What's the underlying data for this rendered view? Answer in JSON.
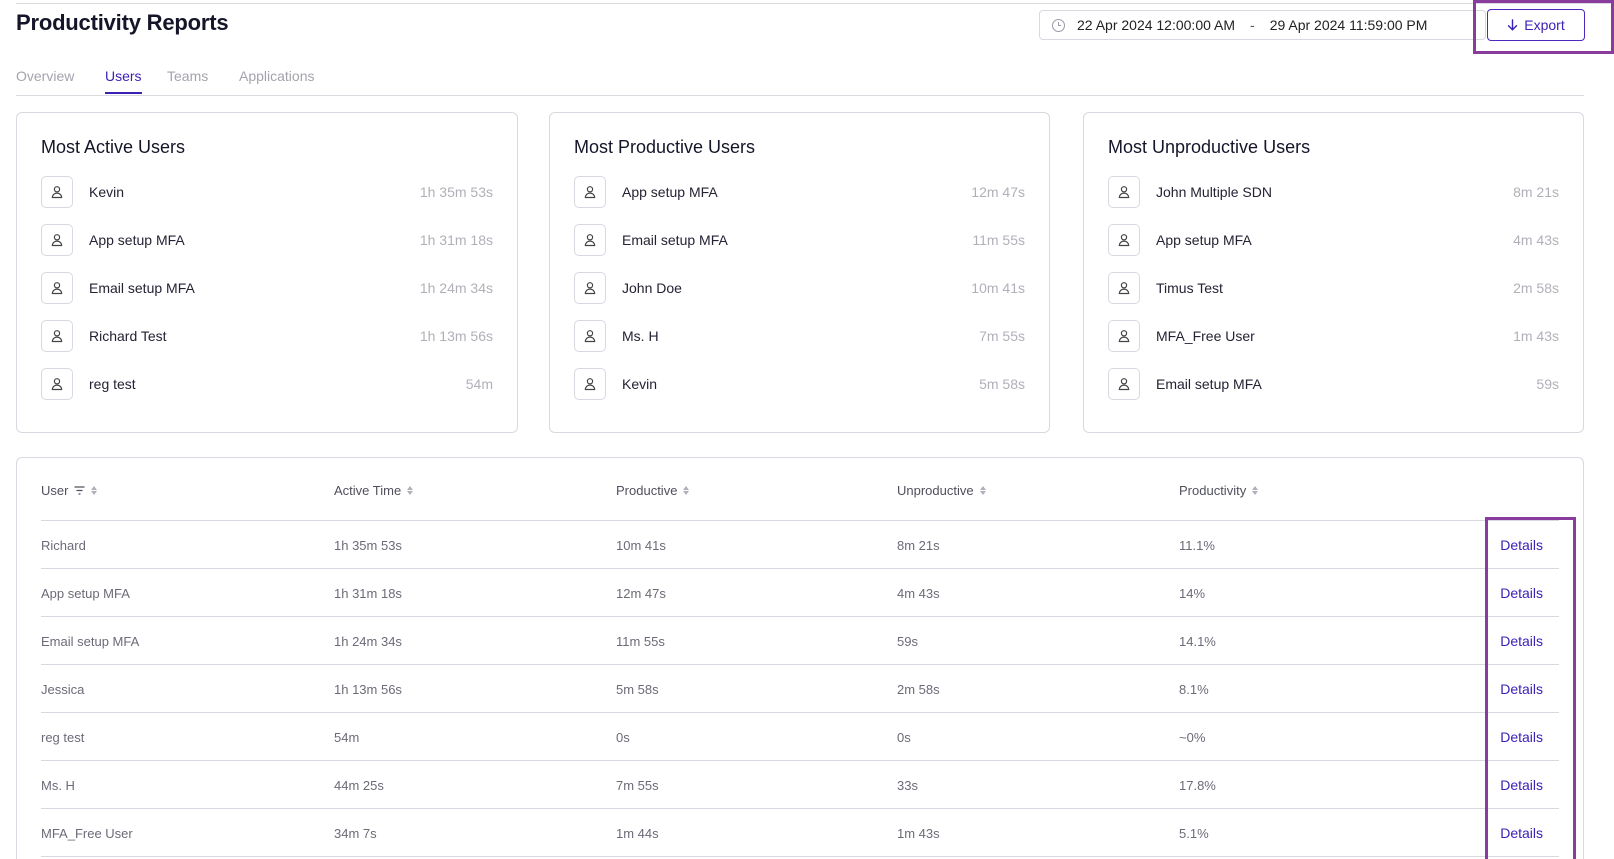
{
  "header": {
    "title": "Productivity Reports",
    "date_start": "22 Apr 2024 12:00:00 AM",
    "date_separator": "-",
    "date_end": "29 Apr 2024 11:59:00 PM",
    "export_label": "Export"
  },
  "tabs": [
    {
      "label": "Overview"
    },
    {
      "label": "Users"
    },
    {
      "label": "Teams"
    },
    {
      "label": "Applications"
    }
  ],
  "active_tab": "Users",
  "cards": [
    {
      "title": "Most Active Users",
      "rows": [
        {
          "name": "Kevin",
          "time": "1h 35m 53s"
        },
        {
          "name": "App setup MFA",
          "time": "1h 31m 18s"
        },
        {
          "name": "Email setup MFA",
          "time": "1h 24m 34s"
        },
        {
          "name": "Richard Test",
          "time": "1h 13m 56s"
        },
        {
          "name": "reg test",
          "time": "54m"
        }
      ]
    },
    {
      "title": "Most Productive Users",
      "rows": [
        {
          "name": "App setup MFA",
          "time": "12m 47s"
        },
        {
          "name": "Email setup MFA",
          "time": "11m 55s"
        },
        {
          "name": "John Doe",
          "time": "10m 41s"
        },
        {
          "name": "Ms. H",
          "time": "7m 55s"
        },
        {
          "name": "Kevin",
          "time": "5m 58s"
        }
      ]
    },
    {
      "title": "Most Unproductive Users",
      "rows": [
        {
          "name": "John Multiple SDN",
          "time": "8m 21s"
        },
        {
          "name": "App setup MFA",
          "time": "4m 43s"
        },
        {
          "name": "Timus Test",
          "time": "2m 58s"
        },
        {
          "name": "MFA_Free User",
          "time": "1m 43s"
        },
        {
          "name": "Email setup MFA",
          "time": "59s"
        }
      ]
    }
  ],
  "table": {
    "columns": [
      "User",
      "Active Time",
      "Productive",
      "Unproductive",
      "Productivity"
    ],
    "details_label": "Details",
    "rows": [
      {
        "user": "Richard",
        "active": "1h 35m 53s",
        "productive": "10m 41s",
        "unproductive": "8m 21s",
        "productivity": "11.1%"
      },
      {
        "user": "App setup MFA",
        "active": "1h 31m 18s",
        "productive": "12m 47s",
        "unproductive": "4m 43s",
        "productivity": "14%"
      },
      {
        "user": "Email setup MFA",
        "active": "1h 24m 34s",
        "productive": "11m 55s",
        "unproductive": "59s",
        "productivity": "14.1%"
      },
      {
        "user": "Jessica",
        "active": "1h 13m 56s",
        "productive": "5m 58s",
        "unproductive": "2m 58s",
        "productivity": "8.1%"
      },
      {
        "user": "reg test",
        "active": "54m",
        "productive": "0s",
        "unproductive": "0s",
        "productivity": "~0%"
      },
      {
        "user": "Ms. H",
        "active": "44m 25s",
        "productive": "7m 55s",
        "unproductive": "33s",
        "productivity": "17.8%"
      },
      {
        "user": "MFA_Free User",
        "active": "34m 7s",
        "productive": "1m 44s",
        "unproductive": "1m 43s",
        "productivity": "5.1%"
      }
    ]
  },
  "colors": {
    "accent": "#3d21b5",
    "highlight": "#8a3c9c",
    "border": "#d8d8e0",
    "muted_text": "#b0b0b8"
  }
}
